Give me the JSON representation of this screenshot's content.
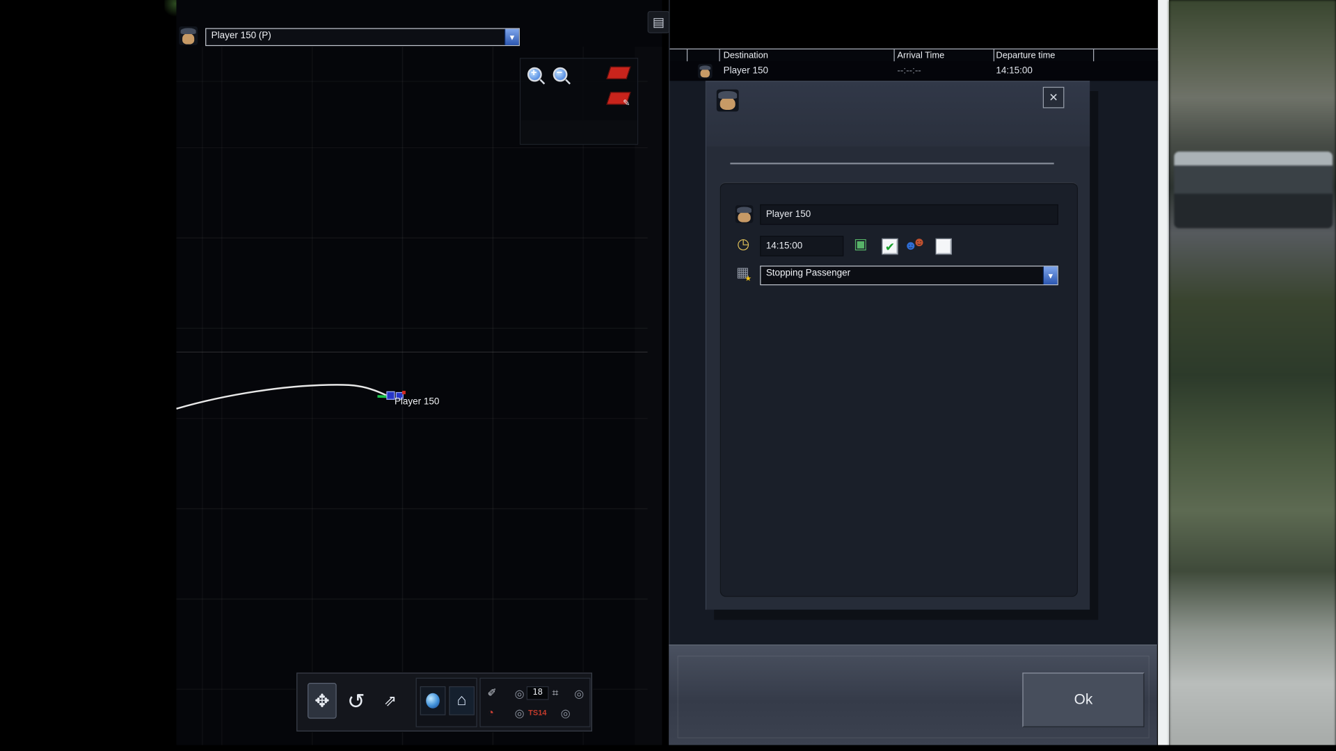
{
  "colors": {
    "accent_blue": "#2f6fd8",
    "check_green": "#18a02c",
    "alert_red": "#c9241c",
    "panel_dark": "#151a24"
  },
  "glyphs": {
    "dropdown_arrow": "▼"
  },
  "top_toolbar": {
    "icons": [
      {
        "name": "save",
        "glyph": "▤"
      },
      {
        "name": "delete",
        "glyph": "▥"
      },
      {
        "name": "grid-small",
        "glyph": "▦"
      },
      {
        "name": "grid-large",
        "glyph": "▦"
      },
      {
        "name": "raise",
        "glyph": "▲"
      },
      {
        "name": "lower",
        "glyph": "▼"
      },
      {
        "name": "shift-left",
        "glyph": "⇆"
      },
      {
        "name": "shift-right",
        "glyph": "⇄"
      },
      {
        "name": "brush",
        "glyph": "✎"
      },
      {
        "name": "driver",
        "glyph": "☻"
      },
      {
        "name": "driver-edit",
        "glyph": "☻"
      },
      {
        "name": "tiles",
        "glyph": "▩"
      },
      {
        "name": "add-service",
        "glyph": "✚"
      },
      {
        "name": "add-path",
        "glyph": "➤"
      },
      {
        "name": "remove",
        "glyph": "✖"
      },
      {
        "name": "service-settings",
        "glyph": "⚙"
      },
      {
        "name": "exit",
        "glyph": "↪"
      },
      {
        "name": "flag",
        "glyph": "⚑"
      },
      {
        "name": "keypad",
        "glyph": "☰"
      },
      {
        "name": "train",
        "glyph": "▣"
      }
    ]
  },
  "map": {
    "driver_selector": {
      "value": "Player 150 (P)"
    },
    "track_label": "Player 150",
    "overlay": {
      "zoom_in": "+",
      "zoom_out": "−"
    },
    "tools": {
      "pan": "✥",
      "rotate": "↺",
      "jump": "⇗",
      "world": "",
      "home": "⌂",
      "measure": "✐",
      "signal": "⌗",
      "gauge": "◔",
      "radio": "◎",
      "counter": "18",
      "marker": "TS14"
    }
  },
  "timetable": {
    "columns": [
      "Destination",
      "Arrival Time",
      "Departure time"
    ],
    "rows": [
      {
        "destination": "Player 150",
        "arrival": "--:--:--",
        "departure": "14:15:00"
      }
    ]
  },
  "dialog": {
    "driver_name": "Player 150",
    "time": "14:15:00",
    "service_type": "Stopping Passenger",
    "close_glyph": "✕",
    "check_glyph": "✔",
    "passenger_glyph": "☻",
    "clock_glyph": "◷",
    "calendar_glyph": "▦",
    "star_glyph": "★",
    "train_glyph": "▣",
    "ok_label": "Ok"
  }
}
